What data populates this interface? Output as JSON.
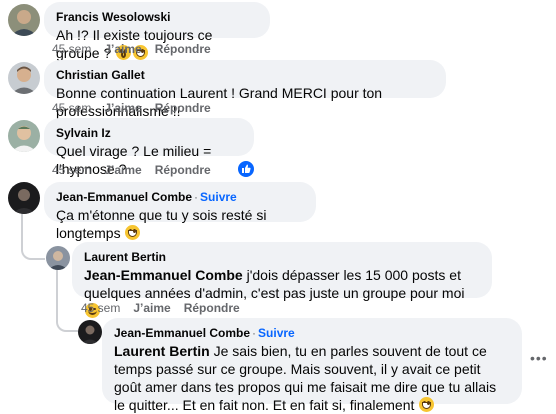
{
  "actions": {
    "age": "45 sem",
    "like": "J’aime",
    "reply": "Répondre"
  },
  "icons": {
    "emoji_flushed": "flushed-face-emoji",
    "emoji_grin": "grinning-face-emoji",
    "emoji_wink": "winking-face-emoji",
    "like": "like-thumb-icon",
    "more": "more-options-icon"
  },
  "colors": {
    "bubble": "#f0f2f5",
    "follow": "#0866ff",
    "meta": "#65676b",
    "line": "#ced0d4"
  },
  "comments": [
    {
      "author": "Francis Wesolowski",
      "text": "Ah !? Il existe toujours ce groupe ?"
    },
    {
      "author": "Christian Gallet",
      "text": "Bonne continuation Laurent ! Grand MERCI pour ton professionnalisme !!"
    },
    {
      "author": "Sylvain Iz",
      "text": "Quel virage ? Le milieu = l'hypnose ?"
    },
    {
      "author": "Jean-Emmanuel Combe",
      "follow": "Suivre",
      "text": "Ça m'étonne que tu y sois resté si longtemps"
    }
  ],
  "reply1": {
    "author": "Laurent Bertin",
    "mention": "Jean-Emmanuel Combe",
    "text": "j'dois dépasser les 15 000 posts et quelques années d'admin, c'est pas juste un groupe pour moi"
  },
  "reply2": {
    "author": "Jean-Emmanuel Combe",
    "follow": "Suivre",
    "mention": "Laurent Bertin",
    "text": "Je sais bien, tu en parles souvent de tout ce temps passé sur ce groupe. Mais souvent, il y avait ce petit goût amer dans tes propos qui me faisait me dire que tu allais le quitter... Et en fait non. Et en fait si, finalement"
  }
}
